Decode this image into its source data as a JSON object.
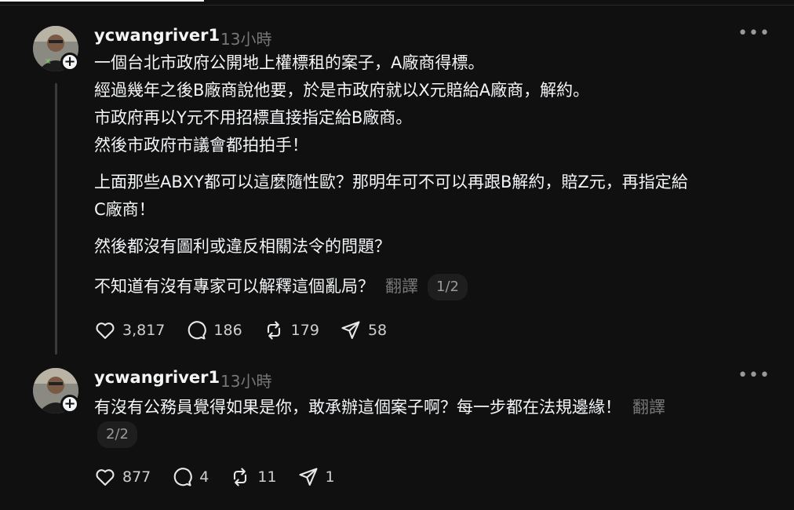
{
  "posts": [
    {
      "username": "ycwangriver1",
      "time": "13小時",
      "lines": [
        "一個台北市政府公開地上權標租的案子，A廠商得標。",
        "經過幾年之後B廠商說他要，於是市政府就以X元賠給A廠商，解約。",
        "市政府再以Y元不用招標直接指定給B廠商。",
        "然後市政府市議會都拍拍手！",
        "上面那些ABXY都可以這麼隨性歐？那明年可不可以再跟B解約，賠Z元，再指定給",
        "C廠商！",
        "然後都沒有圖利或違反相關法令的問題？",
        "不知道有沒有專家可以解釋這個亂局？"
      ],
      "translate": "翻譯",
      "pager": "1/2",
      "likes": "3,817",
      "comments": "186",
      "reposts": "179",
      "shares": "58"
    },
    {
      "username": "ycwangriver1",
      "time": "13小時",
      "lines": [
        "有沒有公務員覺得如果是你，敢承辦這個案子啊？每一步都在法規邊緣！"
      ],
      "translate": "翻譯",
      "pager": "2/2",
      "likes": "877",
      "comments": "4",
      "reposts": "11",
      "shares": "1"
    }
  ],
  "icons": {
    "like": "heart-icon",
    "comment": "comment-bubble-icon",
    "repost": "repost-icon",
    "share": "send-icon",
    "more": "more-options-icon",
    "follow": "plus-icon"
  },
  "colors": {
    "background": "#101010",
    "text": "#f3f5f7",
    "muted": "#777777"
  }
}
